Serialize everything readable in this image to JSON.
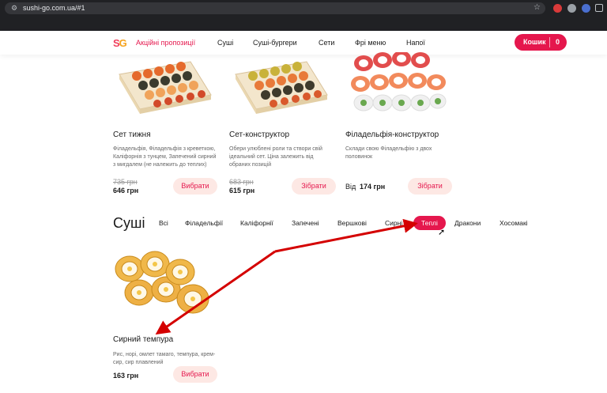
{
  "browser": {
    "url": "sushi-go.com.ua/#1"
  },
  "header": {
    "logo": {
      "s": "S",
      "g": "G"
    },
    "nav": [
      {
        "label": "Акційні пропозиції",
        "promo": true
      },
      {
        "label": "Суші"
      },
      {
        "label": "Суші-бургери"
      },
      {
        "label": "Сети"
      },
      {
        "label": "Фрі меню"
      },
      {
        "label": "Напої"
      }
    ],
    "cart_label": "Кошик",
    "cart_count": "0"
  },
  "sets": [
    {
      "title": "Сет тижня",
      "desc": "Філадельфія, Філадельфія з креветкою, Каліфорнія з тунцем, Запечений сирний з мигдалем (не належить до теплих)",
      "old_price": "735 грн",
      "price": "646 грн",
      "button": "Вибрати"
    },
    {
      "title": "Сет-конструктор",
      "desc": "Обери улюблені роли та створи свій ідеальний сет. Ціна залежить від обраних позицій",
      "old_price": "683 грн",
      "price": "615 грн",
      "button": "Зібрати"
    },
    {
      "title": "Філадельфія-конструктор",
      "desc": "Склади свою Філадельфію з двох половинок",
      "price_from": "Від",
      "price": "174 грн",
      "button": "Зібрати"
    }
  ],
  "sushi": {
    "title": "Суші",
    "categories": [
      "Всі",
      "Філадельфії",
      "Каліфорнії",
      "Запечені",
      "Вершкові",
      "Сирні",
      "Теплі",
      "Дракони",
      "Хосомакі"
    ],
    "active_category": "Теплі",
    "products": [
      {
        "title": "Сирний темпура",
        "desc": "Рис, норі, омлет тамаго, темпура, крем-сир, сир плавлений",
        "price": "163 грн",
        "button": "Вибрати"
      }
    ]
  },
  "colors": {
    "accent": "#e5174d",
    "button_bg": "#fde8e4",
    "arrow": "#d40000"
  }
}
